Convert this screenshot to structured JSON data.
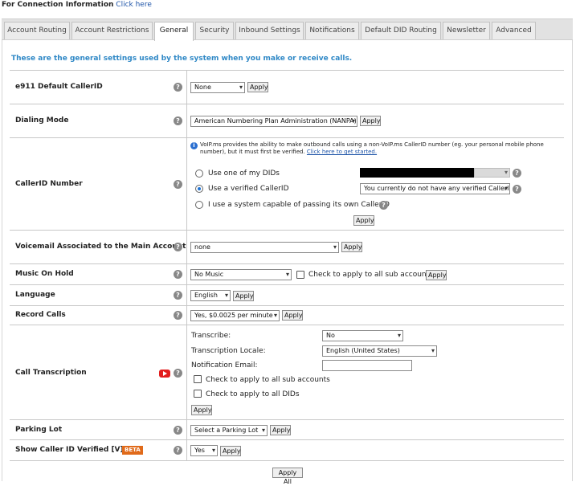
{
  "top": {
    "label": "For Connection Information",
    "link": "Click here"
  },
  "tabs": [
    {
      "label": "Account Routing"
    },
    {
      "label": "Account Restrictions"
    },
    {
      "label": "General"
    },
    {
      "label": "Security"
    },
    {
      "label": "Inbound Settings"
    },
    {
      "label": "Notifications"
    },
    {
      "label": "Default DID Routing"
    },
    {
      "label": "Newsletter"
    },
    {
      "label": "Advanced"
    }
  ],
  "intro": "These are the general settings used by the system when you make or receive calls.",
  "help_glyph": "?",
  "apply_label": "Apply",
  "caret": "▾",
  "rows": {
    "e911": {
      "label": "e911 Default CallerID",
      "value": "None"
    },
    "dialing": {
      "label": "Dialing Mode",
      "value": "American Numbering Plan Administration (NANPA)"
    },
    "callerid": {
      "label": "CallerID Number",
      "info": "VoIP.ms provides the ability to make outbound calls using a non-VoIP.ms CallerID number (eg. your personal mobile phone number), but it must first be verified.",
      "info_link": "Click here to get started.",
      "opt1": "Use one of my DIDs",
      "opt2": "Use a verified CallerID",
      "opt2_value": "You currently do not have any verified CallerID",
      "opt3": "I use a system capable of passing its own CallerID"
    },
    "voicemail": {
      "label": "Voicemail Associated to the Main Account",
      "value": "none"
    },
    "moh": {
      "label": "Music On Hold",
      "value": "No Music",
      "check": "Check to apply to all sub accounts"
    },
    "language": {
      "label": "Language",
      "value": "English"
    },
    "record": {
      "label": "Record Calls",
      "value": "Yes, $0.0025 per minute"
    },
    "transcription": {
      "label": "Call Transcription",
      "transcribe_label": "Transcribe:",
      "transcribe_value": "No",
      "locale_label": "Transcription Locale:",
      "locale_value": "English (United States)",
      "email_label": "Notification Email:",
      "email_value": "",
      "check_sub": "Check to apply to all sub accounts",
      "check_dids": "Check to apply to all DIDs"
    },
    "parking": {
      "label": "Parking Lot",
      "value": "Select a Parking Lot"
    },
    "verified": {
      "label": "Show Caller ID Verified [V]",
      "badge": "BETA",
      "value": "Yes"
    }
  },
  "apply_all": "Apply All"
}
